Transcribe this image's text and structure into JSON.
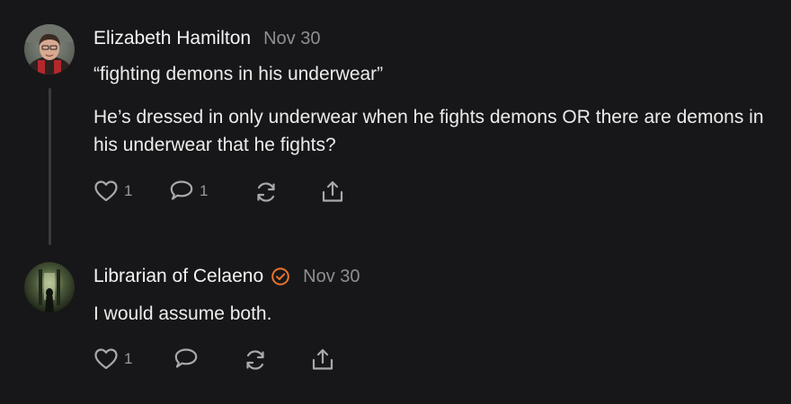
{
  "colors": {
    "background": "#171719",
    "text": "#ececec",
    "muted": "#8e8e93",
    "verified": "#e8742c",
    "thread_line": "#3a3a3c"
  },
  "comments": [
    {
      "author": "Elizabeth Hamilton",
      "date": "Nov 30",
      "paragraphs": [
        "“fighting demons in his underwear”",
        "He’s dressed in only underwear when he fights demons OR there are demons in his underwear that he fights?"
      ],
      "likes": "1",
      "replies": "1",
      "icons": [
        "heart-icon",
        "comment-icon",
        "restack-icon",
        "share-icon"
      ]
    },
    {
      "author": "Librarian of Celaeno",
      "verified": true,
      "verified_icon": "verified-check-icon",
      "date": "Nov 30",
      "paragraphs": [
        "I would assume both."
      ],
      "likes": "1",
      "icons": [
        "heart-icon",
        "comment-icon",
        "restack-icon",
        "share-icon"
      ]
    }
  ]
}
